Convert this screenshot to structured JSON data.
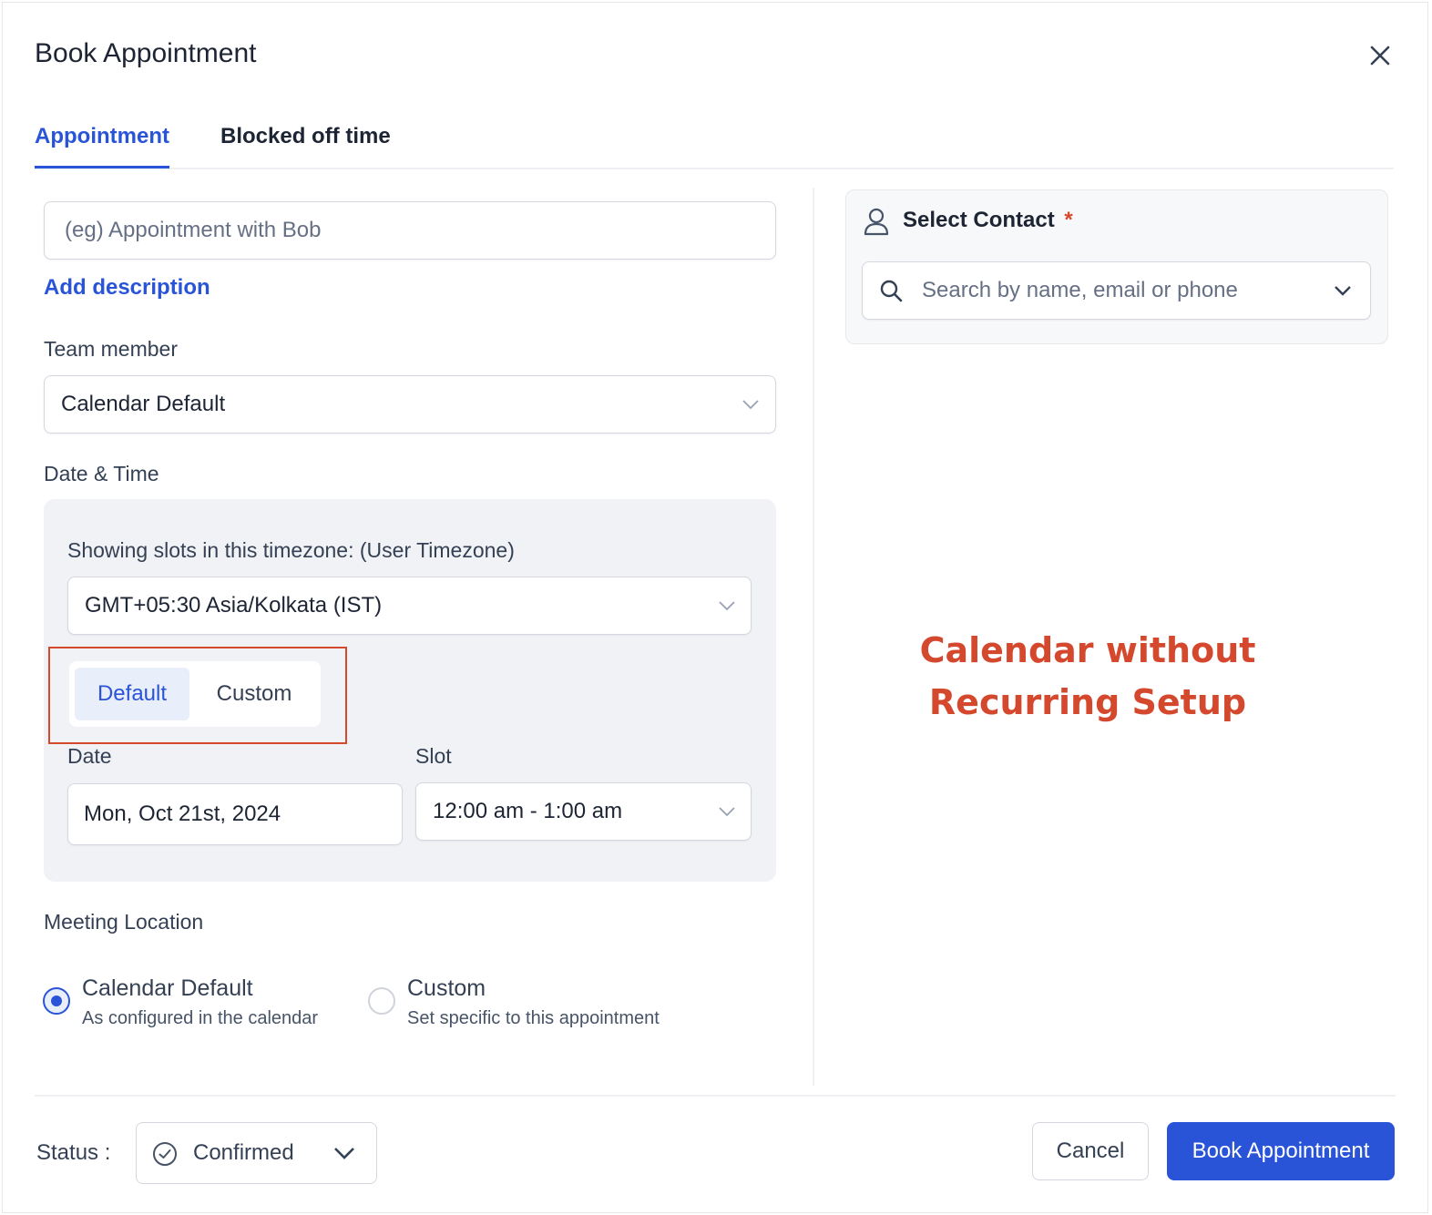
{
  "modal": {
    "title": "Book Appointment"
  },
  "tabs": [
    {
      "label": "Appointment",
      "active": true
    },
    {
      "label": "Blocked off time",
      "active": false
    }
  ],
  "form": {
    "title_placeholder": "(eg) Appointment with Bob",
    "add_description": "Add description",
    "team_member_label": "Team member",
    "team_member_value": "Calendar Default",
    "date_time_label": "Date & Time",
    "timezone_label": "Showing slots in this timezone: (User Timezone)",
    "timezone_value": "GMT+05:30 Asia/Kolkata (IST)",
    "segment": {
      "options": [
        "Default",
        "Custom"
      ],
      "selected": "Default"
    },
    "date_label": "Date",
    "date_value": "Mon, Oct 21st, 2024",
    "slot_label": "Slot",
    "slot_value": "12:00 am - 1:00 am",
    "meeting_location_label": "Meeting Location",
    "location_options": [
      {
        "title": "Calendar Default",
        "desc": "As configured in the calendar",
        "checked": true
      },
      {
        "title": "Custom",
        "desc": "Set specific to this appointment",
        "checked": false
      }
    ]
  },
  "contact": {
    "label": "Select Contact",
    "required_mark": "*",
    "search_placeholder": "Search by name, email or phone"
  },
  "annotation": {
    "line1": "Calendar without",
    "line2": "Recurring Setup",
    "color": "#d4492e"
  },
  "footer": {
    "status_label": "Status :",
    "status_value": "Confirmed",
    "cancel_label": "Cancel",
    "submit_label": "Book Appointment"
  },
  "colors": {
    "primary": "#2a54d8",
    "annotation": "#d4492e",
    "panel_bg": "#f1f2f6"
  },
  "icons": [
    "close-icon",
    "chevron-down-icon",
    "user-icon",
    "search-icon",
    "check-circle-icon"
  ]
}
